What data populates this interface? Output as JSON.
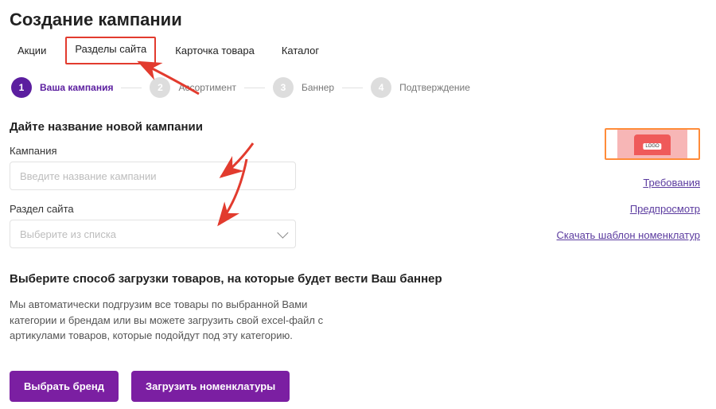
{
  "header": {
    "title": "Создание кампании"
  },
  "tabs": {
    "items": [
      {
        "label": "Акции"
      },
      {
        "label": "Разделы сайта"
      },
      {
        "label": "Карточка товара"
      },
      {
        "label": "Каталог"
      }
    ],
    "active_index": 1
  },
  "stepper": {
    "steps": [
      {
        "num": "1",
        "label": "Ваша кампания"
      },
      {
        "num": "2",
        "label": "Ассортимент"
      },
      {
        "num": "3",
        "label": "Баннер"
      },
      {
        "num": "4",
        "label": "Подтверждение"
      }
    ],
    "active_index": 0
  },
  "form": {
    "name_section_title": "Дайте название новой кампании",
    "campaign_label": "Кампания",
    "campaign_placeholder": "Введите название кампании",
    "campaign_value": "",
    "section_label": "Раздел сайта",
    "section_placeholder": "Выберите из списка",
    "section_value": ""
  },
  "upload": {
    "title": "Выберите способ загрузки товаров, на которые будет вести Ваш баннер",
    "helper": "Мы автоматически подгрузим все товары по выбранной Вами категории и брендам или вы можете загрузить свой excel-файл с артикулами товаров, которые подойдут под эту категорию."
  },
  "buttons": {
    "choose_brand": "Выбрать бренд",
    "upload_nomenclature": "Загрузить номенклатуры"
  },
  "sidebar": {
    "thumb_label": "LOGO",
    "links": {
      "requirements": "Требования",
      "preview": "Предпросмотр",
      "download_template": "Скачать шаблон номенклатур"
    }
  },
  "colors": {
    "accent": "#5b1e9f",
    "button": "#7b1fa2",
    "highlight_border": "#e23b2e",
    "thumb_border": "#ff8c3a"
  }
}
